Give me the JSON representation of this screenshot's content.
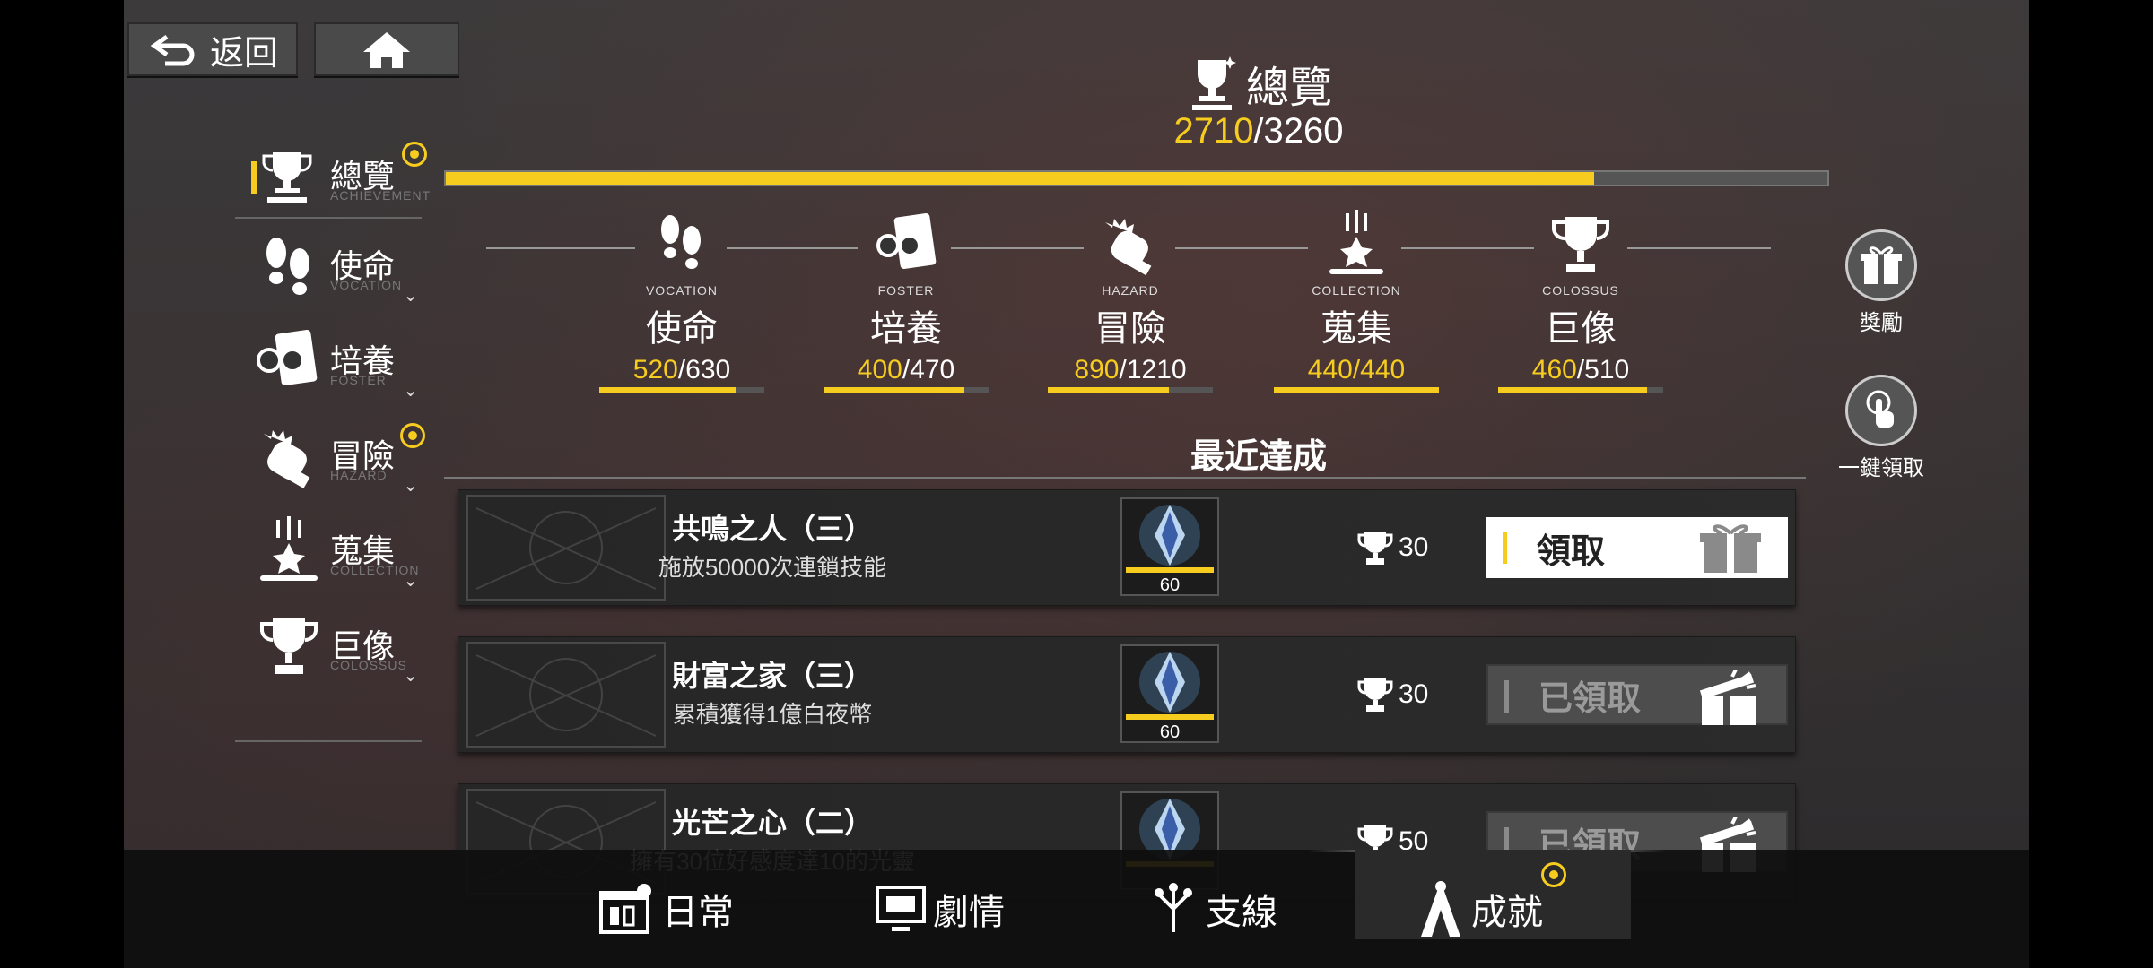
{
  "nav": {
    "back_label": "返回",
    "home_icon": "home-icon"
  },
  "header": {
    "title": "總覽",
    "score_current": "2710",
    "score_total": "/3260",
    "progress": 0.831
  },
  "sidebar": {
    "items": [
      {
        "label": "總覽",
        "sub": "ACHIEVEMENT",
        "icon": "trophy-icon"
      },
      {
        "label": "使命",
        "sub": "VOCATION",
        "icon": "footprints-icon"
      },
      {
        "label": "培養",
        "sub": "FOSTER",
        "icon": "glasses-card-icon"
      },
      {
        "label": "冒險",
        "sub": "HAZARD",
        "icon": "fist-icon"
      },
      {
        "label": "蒐集",
        "sub": "COLLECTION",
        "icon": "collection-icon"
      },
      {
        "label": "巨像",
        "sub": "COLOSSUS",
        "icon": "trophy-icon"
      }
    ]
  },
  "categories": [
    {
      "en": "VOCATION",
      "zh": "使命",
      "cur": "520",
      "total": "/630",
      "progress": 0.825
    },
    {
      "en": "FOSTER",
      "zh": "培養",
      "cur": "400",
      "total": "/470",
      "progress": 0.851
    },
    {
      "en": "HAZARD",
      "zh": "冒險",
      "cur": "890",
      "total": "/1210",
      "progress": 0.736
    },
    {
      "en": "COLLECTION",
      "zh": "蒐集",
      "cur": "440",
      "total": "/440",
      "progress": 1.0
    },
    {
      "en": "COLOSSUS",
      "zh": "巨像",
      "cur": "460",
      "total": "/510",
      "progress": 0.902
    }
  ],
  "recent": {
    "title": "最近達成",
    "rows": [
      {
        "name": "共鳴之人（三）",
        "desc": "施放50000次連鎖技能",
        "qty": "60",
        "points": "30",
        "button": "領取",
        "state": "claim"
      },
      {
        "name": "財富之家（三）",
        "desc": "累積獲得1億白夜幣",
        "qty": "60",
        "points": "30",
        "button": "已領取",
        "state": "done"
      },
      {
        "name": "光芒之心（二）",
        "desc": "擁有30位好感度達10的光靈",
        "qty": "",
        "points": "50",
        "button": "已領取",
        "state": "done"
      }
    ]
  },
  "right": {
    "rewards_label": "獎勵",
    "claim_all_label": "一鍵領取"
  },
  "bottom_nav": [
    {
      "label": "日常",
      "icon": "calendar-icon"
    },
    {
      "label": "劇情",
      "icon": "monitor-icon"
    },
    {
      "label": "支線",
      "icon": "branch-icon"
    },
    {
      "label": "成就",
      "icon": "achievement-icon"
    }
  ],
  "colors": {
    "accent": "#f6cc1f",
    "bg": "#343233"
  }
}
